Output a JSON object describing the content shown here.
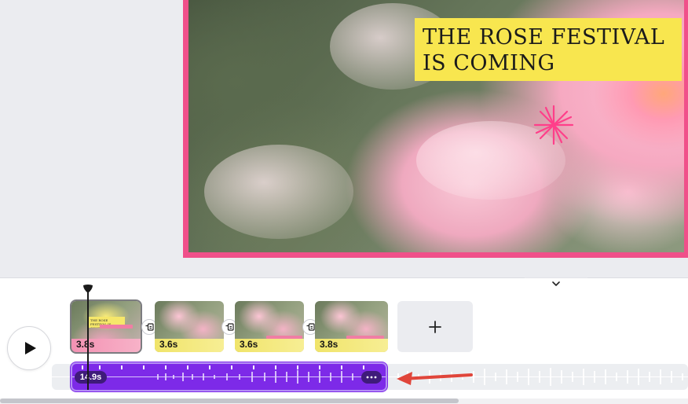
{
  "design": {
    "title_line1": "THE ROSE FESTIVAL",
    "title_line2": "IS COMING",
    "frame_color": "#f0508a",
    "title_box_color": "#f8e64f"
  },
  "timeline": {
    "clips": [
      {
        "duration": "3.8s",
        "selected": true,
        "mini_title": "THE ROSE FESTIVAL IS COMING"
      },
      {
        "duration": "3.6s",
        "selected": false
      },
      {
        "duration": "3.6s",
        "selected": false
      },
      {
        "duration": "3.8s",
        "selected": false
      }
    ],
    "audio": {
      "duration": "14.9s",
      "color": "#7d2ae8"
    }
  },
  "icons": {
    "play": "play-icon",
    "add": "plus-icon",
    "transition": "transition-icon",
    "collapse": "chevron-down-icon",
    "more": "more-horizontal-icon",
    "annotation": "red-arrow-icon"
  },
  "colors": {
    "annotation_arrow": "#e0453a",
    "audio_selected": "#7d2ae8"
  }
}
